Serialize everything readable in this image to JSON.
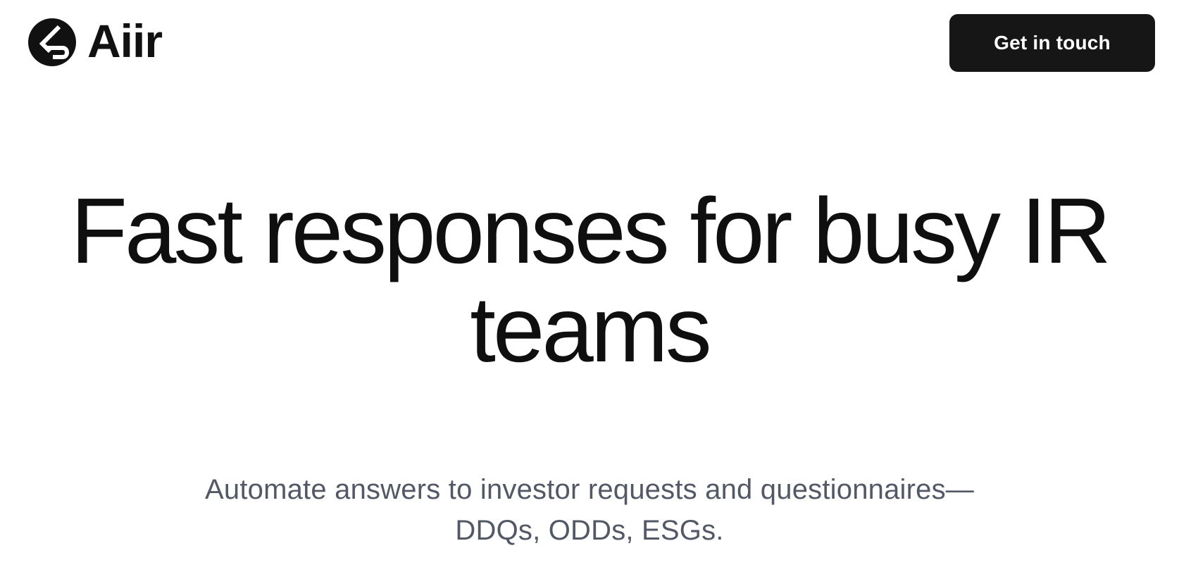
{
  "header": {
    "brand_name": "Aiir",
    "brand_icon": "aiir-logo-icon",
    "cta_label": "Get in touch"
  },
  "hero": {
    "title": "Fast responses for busy IR teams",
    "subtitle": "Automate answers to investor requests and questionnaires—DDQs, ODDs, ESGs."
  },
  "colors": {
    "background": "#ffffff",
    "text": "#0f0f10",
    "subtitle": "#525866",
    "button_bg": "#161617",
    "button_text": "#ffffff"
  }
}
